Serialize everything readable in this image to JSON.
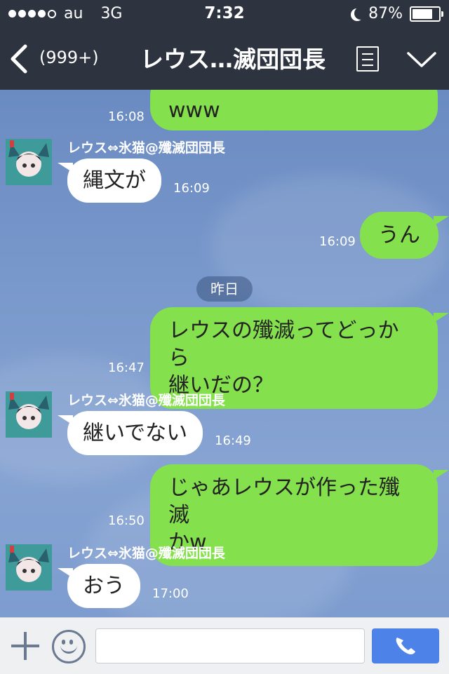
{
  "status_bar": {
    "carrier": "au",
    "network": "3G",
    "time": "7:32",
    "battery_percent": "87%",
    "battery_level": 0.87
  },
  "header": {
    "back_count": "(999+)",
    "title": "レウス…滅団団長"
  },
  "chat": {
    "date_divider": "昨日",
    "sender_name": "レウス⇔氷猫@殲滅団団長",
    "messages": [
      {
        "from": "me",
        "text": "www",
        "time": "16:08"
      },
      {
        "from": "them",
        "text": "縄文が",
        "time": "16:09"
      },
      {
        "from": "me",
        "text": "うん",
        "time": "16:09"
      },
      {
        "from": "me",
        "text_line1": "レウスの殲滅ってどっから",
        "text_line2": "継いだの？",
        "time": "16:47"
      },
      {
        "from": "them",
        "text": "継いでない",
        "time": "16:49"
      },
      {
        "from": "me",
        "text_line1": "じゃあレウスが作った殲滅",
        "text_line2": "かw",
        "time": "16:50"
      },
      {
        "from": "them",
        "text": "おう",
        "time": "17:00"
      }
    ]
  },
  "input_bar": {
    "placeholder": ""
  },
  "colors": {
    "bar_bg": "#2d3440",
    "my_bubble": "#84e04c",
    "their_bubble": "#ffffff",
    "send_button": "#4d83e8"
  }
}
